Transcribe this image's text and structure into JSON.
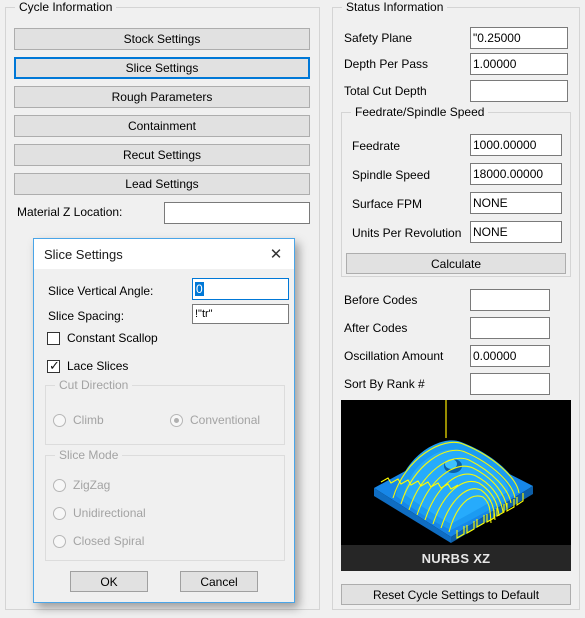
{
  "colors": {
    "accent": "#0078d7",
    "dialog_border": "#4aa5e8",
    "window_bg": "#f0f0f0",
    "field_bg": "#ffffff",
    "button_bg": "#e1e1e1",
    "preview_bg": "#000000",
    "preview_surface": "#11a0f0",
    "preview_toolpath": "#ffff00",
    "disabled_text": "#a3a3a3"
  },
  "cycle_information": {
    "title": "Cycle Information",
    "buttons": [
      {
        "label": "Stock Settings",
        "selected": false
      },
      {
        "label": "Slice Settings",
        "selected": true
      },
      {
        "label": "Rough Parameters",
        "selected": false
      },
      {
        "label": "Containment",
        "selected": false
      },
      {
        "label": "Recut Settings",
        "selected": false
      },
      {
        "label": "Lead Settings",
        "selected": false
      }
    ],
    "material_z": {
      "label": "Material Z Location:",
      "value": "",
      "placeholder": ""
    }
  },
  "status_information": {
    "title": "Status Information",
    "fields": [
      {
        "label": "Safety Plane",
        "value": "\"0.25000"
      },
      {
        "label": "Depth Per Pass",
        "value": "1.00000"
      },
      {
        "label": "Total Cut Depth",
        "value": ""
      }
    ],
    "feedrate_group": {
      "title": "Feedrate/Spindle Speed",
      "fields": [
        {
          "label": "Feedrate",
          "value": "1000.00000"
        },
        {
          "label": "Spindle Speed",
          "value": "18000.00000"
        },
        {
          "label": "Surface FPM",
          "value": "NONE"
        },
        {
          "label": "Units Per Revolution",
          "value": "NONE"
        }
      ],
      "calculate_label": "Calculate"
    },
    "code_fields": [
      {
        "label": "Before Codes",
        "value": ""
      },
      {
        "label": "After Codes",
        "value": ""
      },
      {
        "label": "Oscillation Amount",
        "value": "0.00000"
      },
      {
        "label": "Sort By Rank #",
        "value": ""
      }
    ],
    "preview": {
      "caption": "NURBS XZ"
    },
    "reset_label": "Reset Cycle Settings to Default"
  },
  "slice_dialog": {
    "title": "Slice Settings",
    "close_glyph": "✕",
    "vertical_angle": {
      "label": "Slice Vertical Angle:",
      "value": "0"
    },
    "spacing": {
      "label": "Slice Spacing:",
      "value": "!\"tr\""
    },
    "checkboxes": [
      {
        "label": "Constant Scallop",
        "checked": false
      },
      {
        "label": "Lace Slices",
        "checked": true
      }
    ],
    "cut_direction": {
      "title": "Cut Direction",
      "options": [
        {
          "label": "Climb",
          "selected": false
        },
        {
          "label": "Conventional",
          "selected": true
        }
      ]
    },
    "slice_mode": {
      "title": "Slice Mode",
      "options": [
        {
          "label": "ZigZag",
          "selected": false
        },
        {
          "label": "Unidirectional",
          "selected": false
        },
        {
          "label": "Closed Spiral",
          "selected": false
        }
      ]
    },
    "ok_label": "OK",
    "cancel_label": "Cancel"
  }
}
